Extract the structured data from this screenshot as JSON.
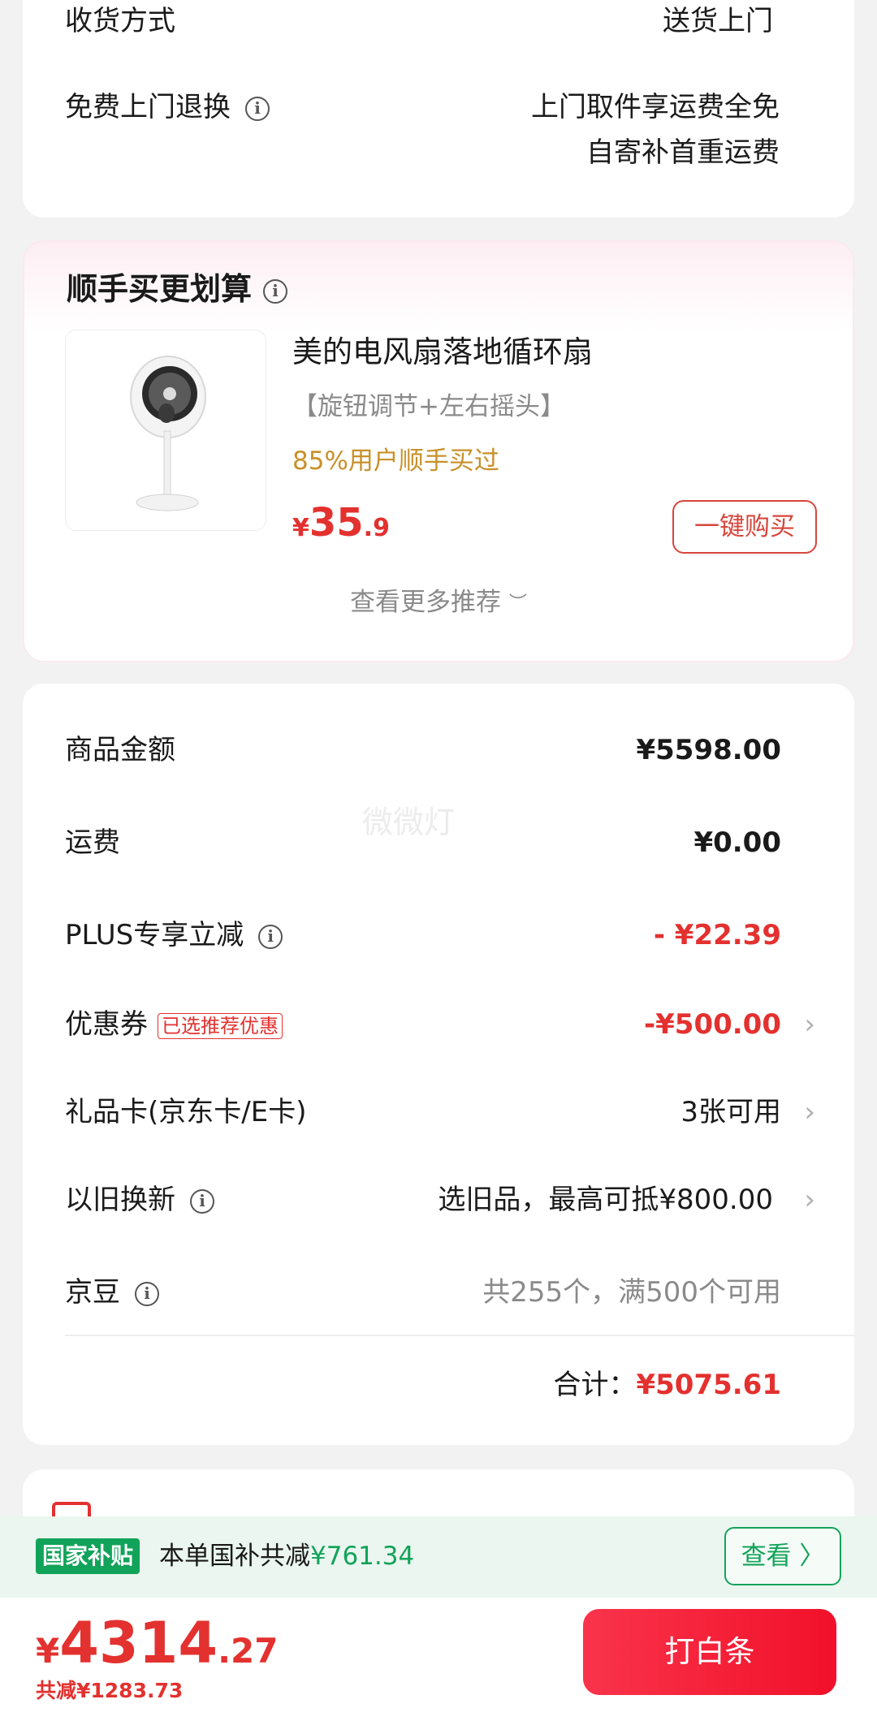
{
  "delivery": {
    "method_label": "收货方式",
    "method_value": "送货上门",
    "return_label": "免费上门退换",
    "return_value_line1": "上门取件享运费全免",
    "return_value_line2": "自寄补首重运费"
  },
  "recommend": {
    "title": "顺手买更划算",
    "product": {
      "name": "美的电风扇落地循环扇",
      "tag": "【旋钮调节+左右摇头】",
      "stat": "85%用户顺手买过",
      "price_currency": "¥",
      "price_int": "35",
      "price_dec": ".9",
      "buy_label": "一键购买"
    },
    "more_label": "查看更多推荐"
  },
  "price_detail": {
    "watermark": "微微灯",
    "rows": {
      "goods_amount": {
        "label": "商品金额",
        "value": "¥5598.00"
      },
      "shipping": {
        "label": "运费",
        "value": "¥0.00"
      },
      "plus": {
        "label": "PLUS专享立减",
        "value": "- ¥22.39"
      },
      "coupon": {
        "label": "优惠券",
        "badge": "已选推荐优惠",
        "value": "-¥500.00"
      },
      "giftcard": {
        "label": "礼品卡(京东卡/E卡)",
        "value": "3张可用"
      },
      "tradein": {
        "label": "以旧换新",
        "value": "选旧品，最高可抵¥800.00"
      },
      "jingdou": {
        "label": "京豆",
        "value": "共255个，满500个可用"
      }
    },
    "total_label": "合计：",
    "total_value": "¥5075.61"
  },
  "subsidy": {
    "badge": "国家补贴",
    "text": "本单国补共减",
    "amount": "¥761.34",
    "view_label": "查看 〉"
  },
  "bottom": {
    "currency": "¥",
    "price_int": "4314",
    "price_dec": ".27",
    "saved": "共减¥1283.73",
    "pay_label": "打白条"
  },
  "colors": {
    "accent_red": "#e3312f",
    "subsidy_green": "#12a35a",
    "pay_button": "#f9344b"
  }
}
